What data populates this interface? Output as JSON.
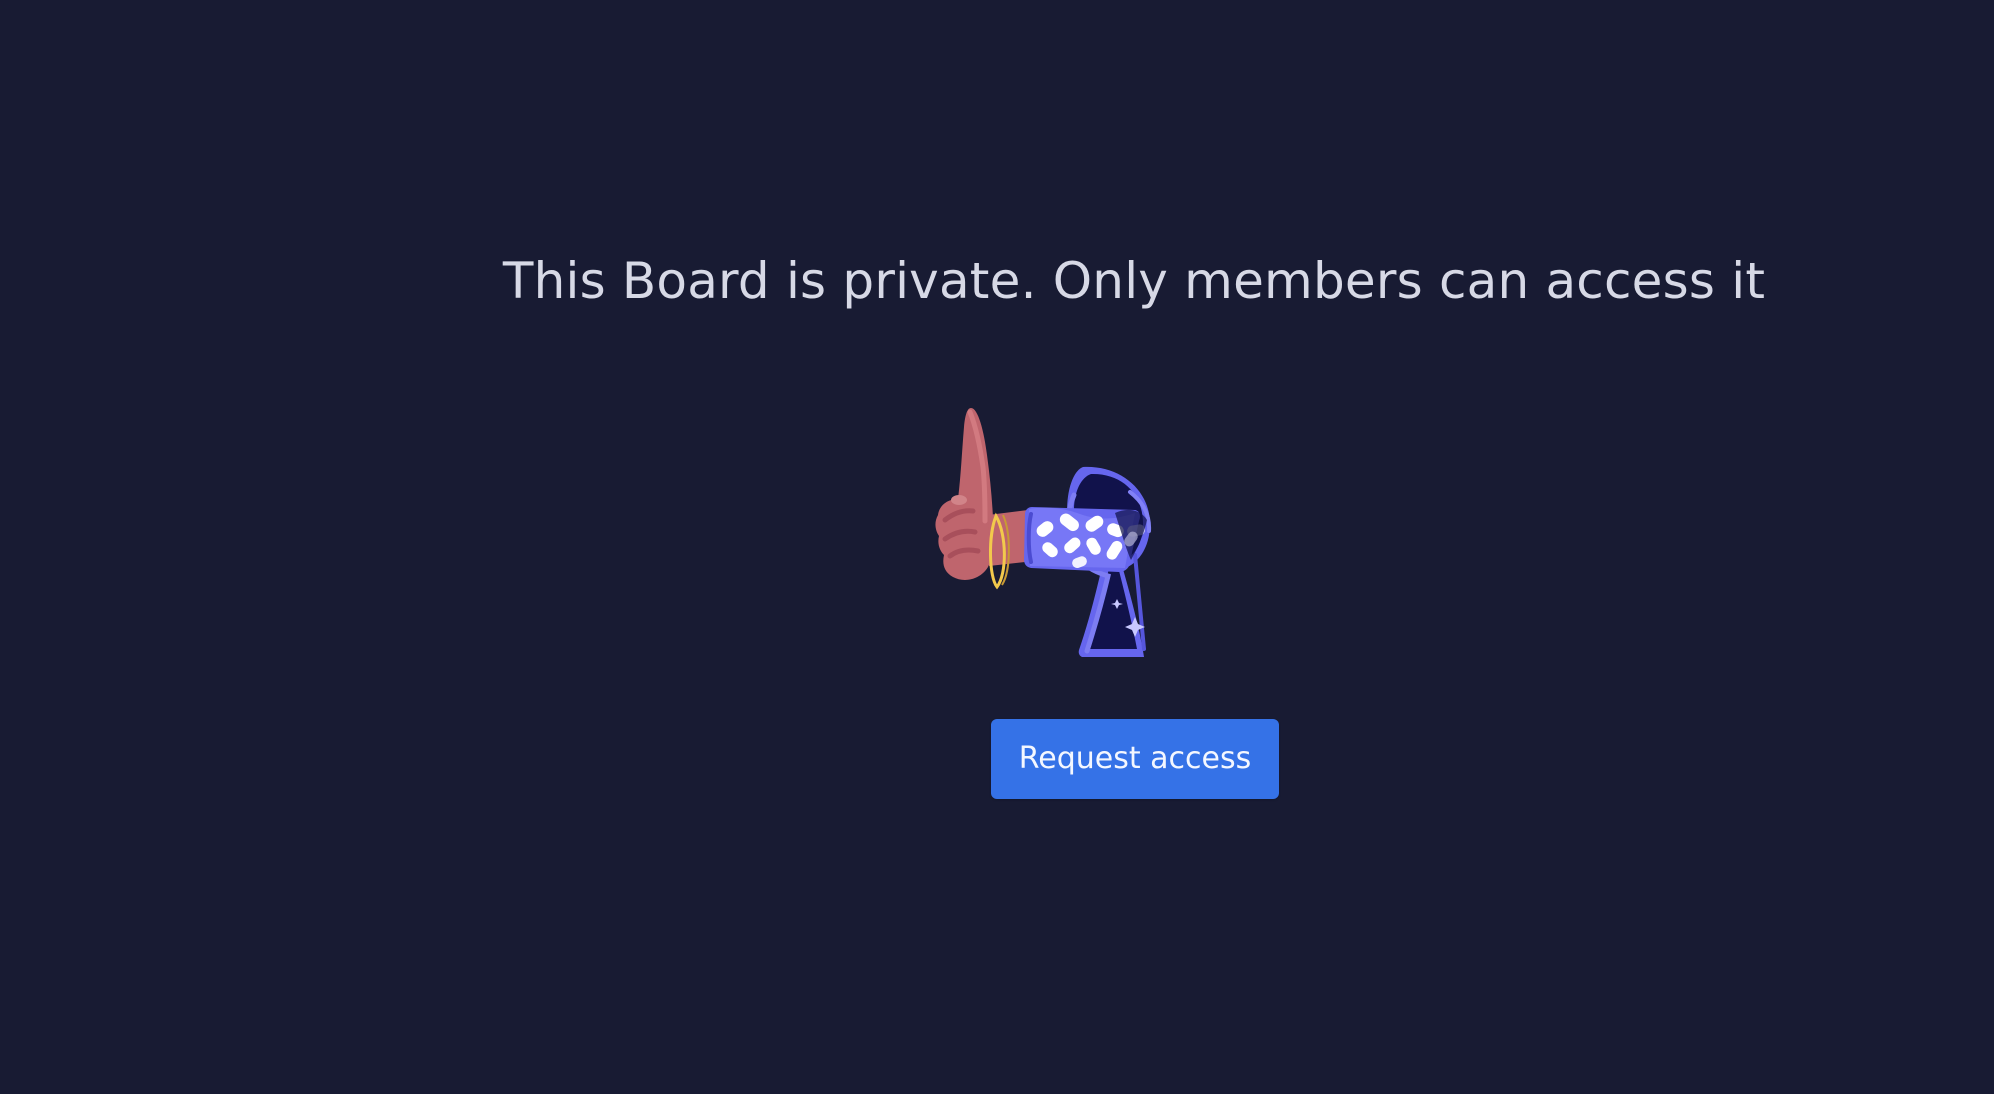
{
  "page": {
    "background_color": "#181b33",
    "title": "This Board is private. Only members can access it"
  },
  "illustration": {
    "icon": "private-board-keyhole-hand-illustration",
    "colors": {
      "hand": "#bf656d",
      "keyhole": "#6666ee",
      "keyhole_inner": "#11124b",
      "bracelet": "#f2c94c"
    }
  },
  "actions": {
    "request_access_label": "Request access",
    "button_color": "#3572e7"
  }
}
